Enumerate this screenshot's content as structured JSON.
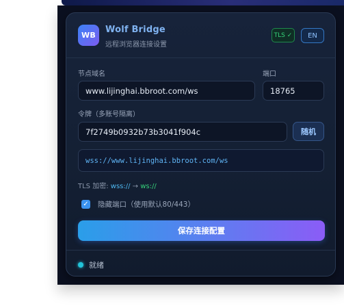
{
  "app": {
    "logo_text": "WB",
    "title": "Wolf Bridge",
    "subtitle": "远程浏览器连接设置",
    "tls_badge": "TLS ✓",
    "lang_button": "EN"
  },
  "form": {
    "host_label": "节点域名",
    "host_value": "www.lijinghai.bbroot.com/ws",
    "port_label": "端口",
    "port_value": "18765",
    "token_label": "令牌（多账号隔离）",
    "token_value": "7f2749b0932b73b3041f904c",
    "random_button": "随机",
    "url_preview": "wss://www.lijinghai.bbroot.com/ws",
    "tls_prefix": "TLS 加密:",
    "tls_from": "wss://",
    "tls_arrow": "→",
    "tls_to": "ws://",
    "hide_port_checked": true,
    "hide_port_label": "隐藏端口（使用默认80/443）",
    "save_button": "保存连接配置"
  },
  "status": {
    "text": "就绪",
    "color": "#22c3d8"
  },
  "colors": {
    "accent": "#3b93f0",
    "gradient_start": "#2a9ee9",
    "gradient_end": "#8b5cf6",
    "tls_green": "#35d27a"
  }
}
